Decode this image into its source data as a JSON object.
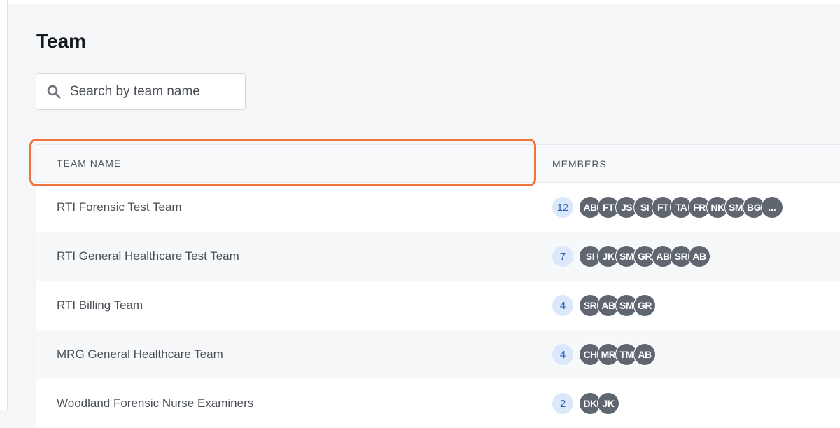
{
  "page": {
    "title": "Team"
  },
  "search": {
    "placeholder": "Search by team name"
  },
  "table": {
    "columns": {
      "name": "TEAM NAME",
      "members": "MEMBERS"
    },
    "rows": [
      {
        "name": "RTI Forensic Test Team",
        "count": "12",
        "avatars": [
          "AB",
          "FT",
          "JS",
          "SI",
          "FT",
          "TA",
          "FR",
          "NK",
          "SM",
          "BG",
          "..."
        ]
      },
      {
        "name": "RTI General Healthcare Test Team",
        "count": "7",
        "avatars": [
          "SI",
          "JK",
          "SM",
          "GR",
          "AB",
          "SR",
          "AB"
        ]
      },
      {
        "name": "RTI Billing Team",
        "count": "4",
        "avatars": [
          "SR",
          "AB",
          "SM",
          "GR"
        ]
      },
      {
        "name": "MRG General Healthcare Team",
        "count": "4",
        "avatars": [
          "CH",
          "MR",
          "TM",
          "AB"
        ]
      },
      {
        "name": "Woodland Forensic Nurse Examiners",
        "count": "2",
        "avatars": [
          "DK",
          "JK"
        ]
      }
    ]
  },
  "colors": {
    "highlight": "#f0733b",
    "avatar_bg": "#5f6670",
    "count_badge_bg": "#dbe7fb",
    "count_badge_text": "#2f5fb0"
  },
  "icons": {
    "search": "search-icon"
  }
}
